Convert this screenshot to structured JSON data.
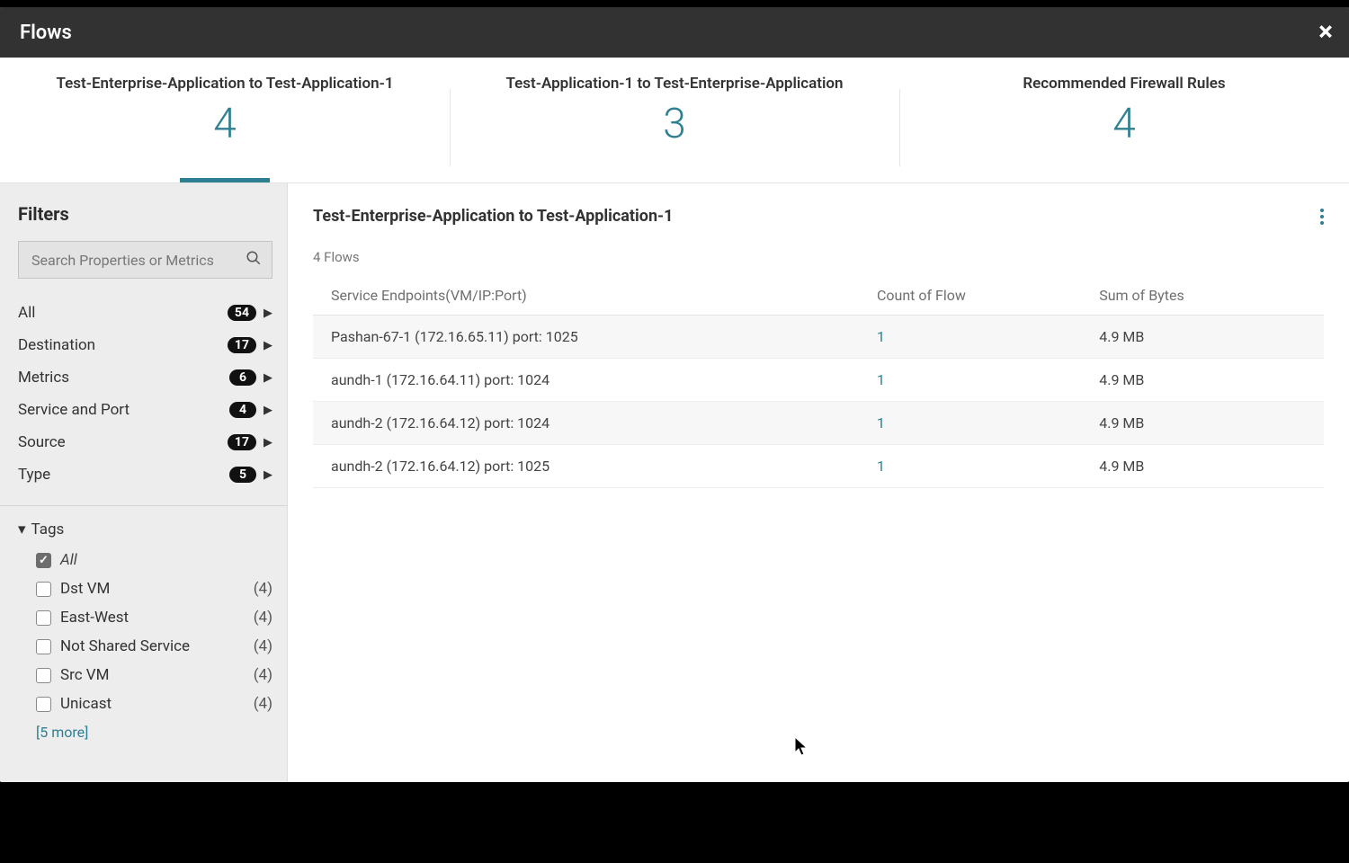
{
  "header": {
    "title": "Flows",
    "close_label": "×"
  },
  "tabs": [
    {
      "label": "Test-Enterprise-Application to Test-Application-1",
      "count": "4",
      "active": true
    },
    {
      "label": "Test-Application-1 to Test-Enterprise-Application",
      "count": "3",
      "active": false
    },
    {
      "label": "Recommended Firewall Rules",
      "count": "4",
      "active": false
    }
  ],
  "sidebar": {
    "title": "Filters",
    "search_placeholder": "Search Properties or Metrics",
    "categories": [
      {
        "label": "All",
        "count": "54"
      },
      {
        "label": "Destination",
        "count": "17"
      },
      {
        "label": "Metrics",
        "count": "6"
      },
      {
        "label": "Service and Port",
        "count": "4"
      },
      {
        "label": "Source",
        "count": "17"
      },
      {
        "label": "Type",
        "count": "5"
      }
    ],
    "tags_header": "Tags",
    "tags": [
      {
        "label": "All",
        "count": "",
        "all": true,
        "checked": true
      },
      {
        "label": "Dst VM",
        "count": "(4)",
        "checked": false
      },
      {
        "label": "East-West",
        "count": "(4)",
        "checked": false
      },
      {
        "label": "Not Shared Service",
        "count": "(4)",
        "checked": false
      },
      {
        "label": "Src VM",
        "count": "(4)",
        "checked": false
      },
      {
        "label": "Unicast",
        "count": "(4)",
        "checked": false
      }
    ],
    "more_label": "[5 more]"
  },
  "content": {
    "title": "Test-Enterprise-Application to Test-Application-1",
    "flows_count_label": "4 Flows",
    "columns": [
      "Service Endpoints(VM/IP:Port)",
      "Count of Flow",
      "Sum of Bytes"
    ],
    "rows": [
      {
        "endpoint": "Pashan-67-1 (172.16.65.11) port: 1025",
        "count": "1",
        "bytes": "4.9 MB"
      },
      {
        "endpoint": "aundh-1 (172.16.64.11) port: 1024",
        "count": "1",
        "bytes": "4.9 MB"
      },
      {
        "endpoint": "aundh-2 (172.16.64.12) port: 1024",
        "count": "1",
        "bytes": "4.9 MB"
      },
      {
        "endpoint": "aundh-2 (172.16.64.12) port: 1025",
        "count": "1",
        "bytes": "4.9 MB"
      }
    ]
  }
}
